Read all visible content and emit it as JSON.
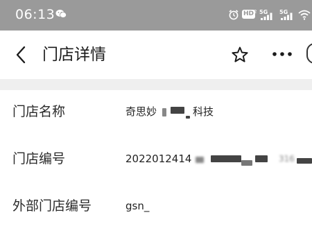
{
  "status_bar": {
    "time": "06:13",
    "hd_label": "HD",
    "hd_sub": "2",
    "signal1_label": "5G",
    "signal2_label": "5G",
    "background_color": "#9a9a9a"
  },
  "nav": {
    "title": "门店详情",
    "back_icon": "chevron-left-icon",
    "favorite_icon": "star-outline-icon",
    "more_icon": "ellipsis-icon"
  },
  "fields": [
    {
      "label": "门店名称",
      "value_visible_start": "奇思妙",
      "value_visible_end": "科技"
    },
    {
      "label": "门店编号",
      "value_visible_start": "2022012414",
      "value_visible_end": "316"
    },
    {
      "label": "外部门店编号",
      "value_visible_start": "gsn_"
    }
  ]
}
